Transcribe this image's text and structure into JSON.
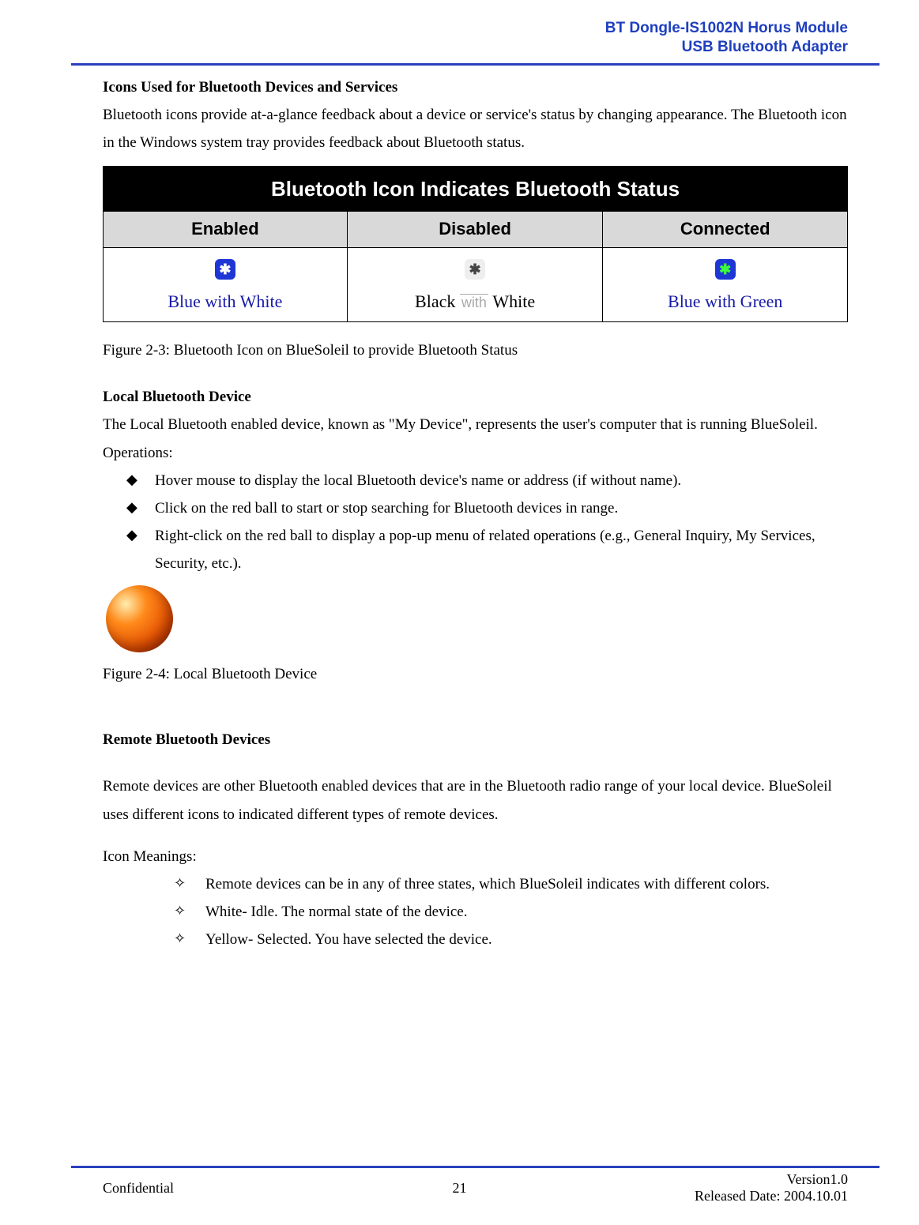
{
  "header": {
    "line1": "BT Dongle-IS1002N Horus Module",
    "line2": "USB Bluetooth Adapter"
  },
  "section1": {
    "heading": "Icons Used for Bluetooth Devices and Services",
    "body": "Bluetooth icons provide at-a-glance feedback about a device or service's status by changing appearance. The Bluetooth icon in the Windows system tray provides feedback about Bluetooth status."
  },
  "status_table": {
    "title": "Bluetooth Icon Indicates Bluetooth Status",
    "columns": {
      "col1": {
        "header": "Enabled",
        "label": "Blue with White",
        "icon": "bt-enabled-icon"
      },
      "col2": {
        "header": "Disabled",
        "label_left": "Black",
        "label_mid": "with",
        "label_right": "White",
        "icon": "bt-disabled-icon"
      },
      "col3": {
        "header": "Connected",
        "label": "Blue with Green",
        "icon": "bt-connected-icon"
      }
    }
  },
  "figure1_caption": "Figure 2-3: Bluetooth Icon on BlueSoleil to provide Bluetooth Status",
  "section2": {
    "heading": "Local Bluetooth Device",
    "body": "The Local Bluetooth enabled device, known as \"My Device\", represents the user's computer that is running BlueSoleil.",
    "operations_label": "Operations:",
    "ops": [
      "Hover mouse to display the local Bluetooth device's name or address (if without name).",
      "Click on the red ball to start or stop searching for Bluetooth devices in range.",
      "Right-click on the red ball to display a pop-up menu of related operations (e.g., General Inquiry, My Services, Security, etc.)."
    ]
  },
  "figure2_caption": "Figure 2-4: Local Bluetooth Device",
  "section3": {
    "heading": "Remote Bluetooth Devices",
    "body": "Remote devices are other Bluetooth enabled devices that are in the Bluetooth radio range of your local device. BlueSoleil uses different icons to indicated different types of remote devices.",
    "icon_meanings_label": "Icon Meanings:",
    "meanings": [
      "Remote devices can be in any of three states, which BlueSoleil indicates with different colors.",
      "White- Idle. The normal state of the device.",
      "Yellow- Selected. You have selected the device."
    ]
  },
  "footer": {
    "left": "Confidential",
    "center": "21",
    "right1": "Version1.0",
    "right2": "Released Date: 2004.10.01"
  }
}
